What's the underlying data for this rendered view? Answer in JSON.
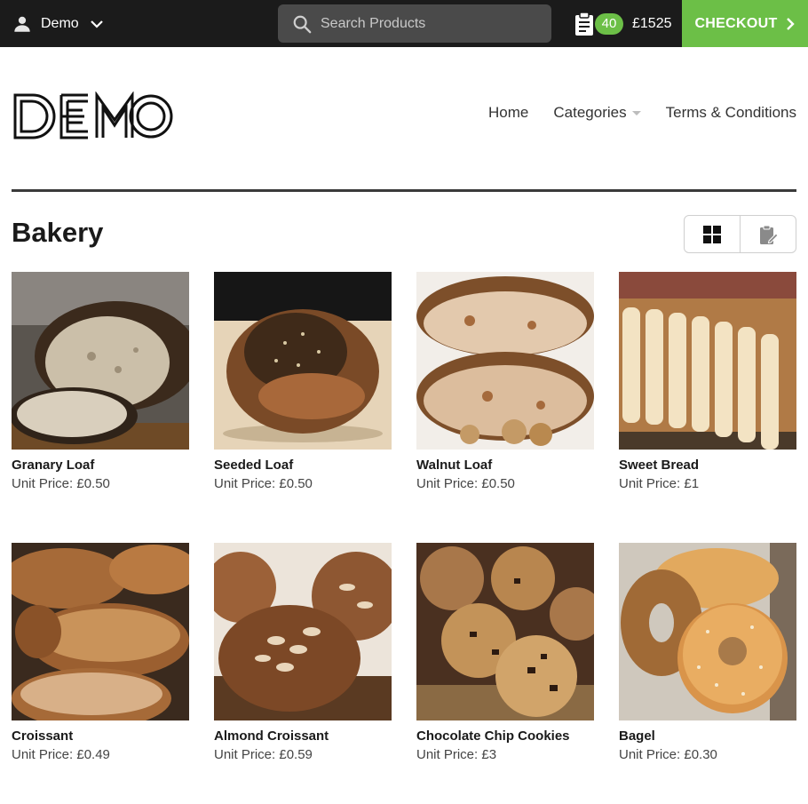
{
  "topbar": {
    "account_label": "Demo",
    "search_placeholder": "Search Products",
    "cart_count": "40",
    "cart_total": "£1525",
    "checkout_label": "CHECKOUT",
    "accent_color": "#6cbf47"
  },
  "header": {
    "logo_text": "DEMO",
    "nav": [
      {
        "label": "Home"
      },
      {
        "label": "Categories"
      },
      {
        "label": "Terms & Conditions"
      }
    ]
  },
  "page": {
    "title": "Bakery",
    "view_modes": [
      "grid-view-icon",
      "quick-order-icon"
    ]
  },
  "products": [
    {
      "name": "Granary Loaf",
      "price": "Unit Price: £0.50"
    },
    {
      "name": "Seeded Loaf",
      "price": "Unit Price: £0.50"
    },
    {
      "name": "Walnut Loaf",
      "price": "Unit Price: £0.50"
    },
    {
      "name": "Sweet Bread",
      "price": "Unit Price: £1"
    },
    {
      "name": "Croissant",
      "price": "Unit Price: £0.49"
    },
    {
      "name": "Almond Croissant",
      "price": "Unit Price: £0.59"
    },
    {
      "name": "Chocolate Chip Cookies",
      "price": "Unit Price: £3"
    },
    {
      "name": "Bagel",
      "price": "Unit Price: £0.30"
    }
  ]
}
